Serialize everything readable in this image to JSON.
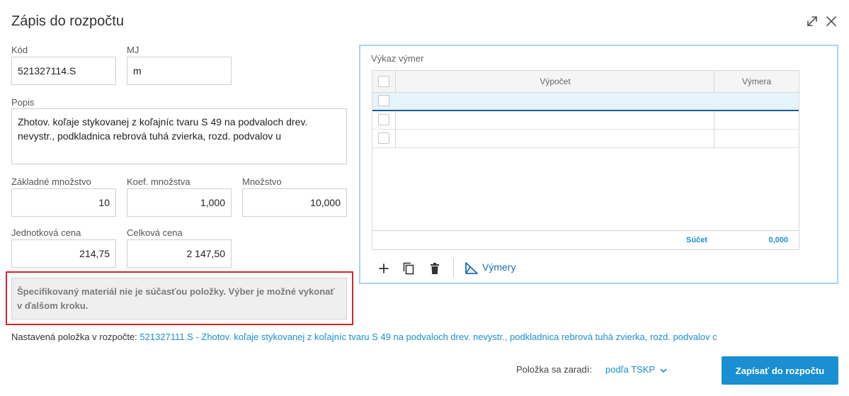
{
  "dialog": {
    "title": "Zápis do rozpočtu"
  },
  "form": {
    "kod": {
      "label": "Kód",
      "value": "521327114.S"
    },
    "mj": {
      "label": "MJ",
      "value": "m"
    },
    "popis": {
      "label": "Popis",
      "value": "Zhotov. koľaje stykovanej z koľajníc tvaru S 49 na podvaloch drev. nevystr., podkladnica rebrová tuhá zvierka, rozd. podvalov u"
    },
    "zakladne_mnozstvo": {
      "label": "Základné množstvo",
      "value": "10"
    },
    "koef_mnozstva": {
      "label": "Koef. množstva",
      "value": "1,000"
    },
    "mnozstvo": {
      "label": "Množstvo",
      "value": "10,000"
    },
    "jednotkova_cena": {
      "label": "Jednotková cena",
      "value": "214,75"
    },
    "celkova_cena": {
      "label": "Celková cena",
      "value": "2 147,50"
    }
  },
  "warning": {
    "text": "Špecifikovaný materiál nie je súčasťou položky. Výber je možné vykonať v ďalšom kroku."
  },
  "nastavena_polozka": {
    "label": "Nastavená položka v rozpočte:",
    "link": "521327111.S - Zhotov. koľaje stykovanej z koľajníc tvaru S 49 na podvaloch drev. nevystr., podkladnica rebrová tuhá zvierka, rozd. podvalov c"
  },
  "vykaz": {
    "title": "Výkaz výmer",
    "columns": [
      "Výpočet",
      "Výmera"
    ],
    "rows": [
      {
        "vypocet": "",
        "vymera": ""
      },
      {
        "vypocet": "",
        "vymera": ""
      },
      {
        "vypocet": "",
        "vymera": ""
      }
    ],
    "footer_label": "Súčet",
    "footer_value": "0,000",
    "vymery_label": "Výmery"
  },
  "footer": {
    "zaradi_label": "Položka sa zaradí:",
    "zaradi_value": "podľa TSKP",
    "submit_label": "Zapísať do rozpočtu"
  },
  "colors": {
    "accent": "#1a8fd1",
    "warning_outline": "#d9232d",
    "selected_row": "#e5f4fb"
  },
  "icons": [
    "expand-icon",
    "close-icon",
    "add-icon",
    "copy-icon",
    "delete-icon",
    "vymery-icon",
    "chevron-down-icon"
  ]
}
